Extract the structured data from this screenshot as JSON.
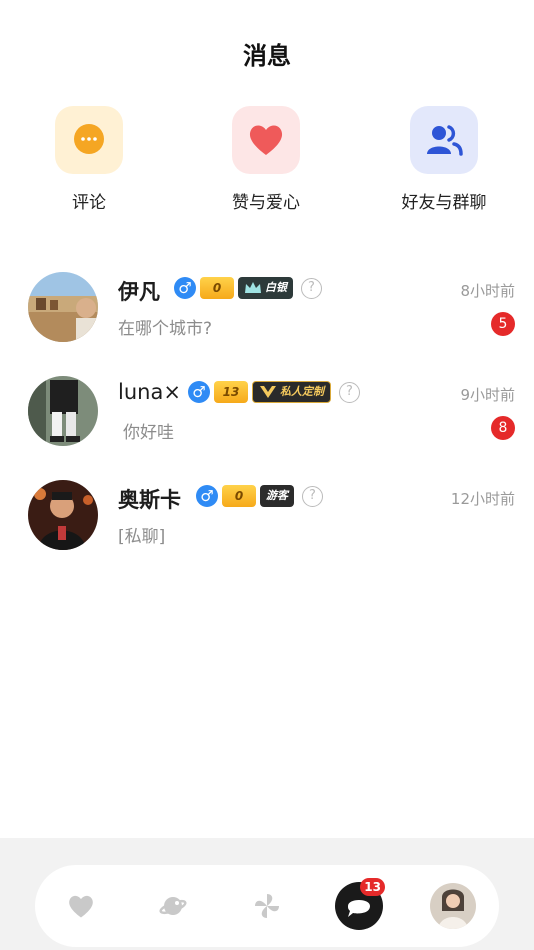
{
  "header": {
    "title": "消息"
  },
  "quick_actions": [
    {
      "label": "评论",
      "icon": "comment-icon",
      "color": "#f5a623"
    },
    {
      "label": "赞与爱心",
      "icon": "heart-icon",
      "color": "#ef5a5a"
    },
    {
      "label": "好友与群聊",
      "icon": "friends-icon",
      "color": "#2e55d6"
    }
  ],
  "conversations": [
    {
      "name": "伊凡",
      "level": "0",
      "tag": "白银",
      "preview": "在哪个城市?",
      "time": "8小时前",
      "unread": "5"
    },
    {
      "name": "luna×",
      "level": "13",
      "tag": "私人定制",
      "preview": "你好哇",
      "time": "9小时前",
      "unread": "8"
    },
    {
      "name": "奥斯卡",
      "level": "0",
      "tag": "游客",
      "preview": "[私聊]",
      "time": "12小时前",
      "unread": ""
    }
  ],
  "tabbar": {
    "items": [
      {
        "icon": "heart-tab-icon"
      },
      {
        "icon": "planet-tab-icon"
      },
      {
        "icon": "pinwheel-tab-icon"
      },
      {
        "icon": "message-tab-icon",
        "badge": "13"
      },
      {
        "icon": "profile-avatar"
      }
    ]
  },
  "colors": {
    "accent_red": "#e52a2a",
    "male_blue": "#2f8bf5",
    "level_gold": "#f6a91a"
  }
}
